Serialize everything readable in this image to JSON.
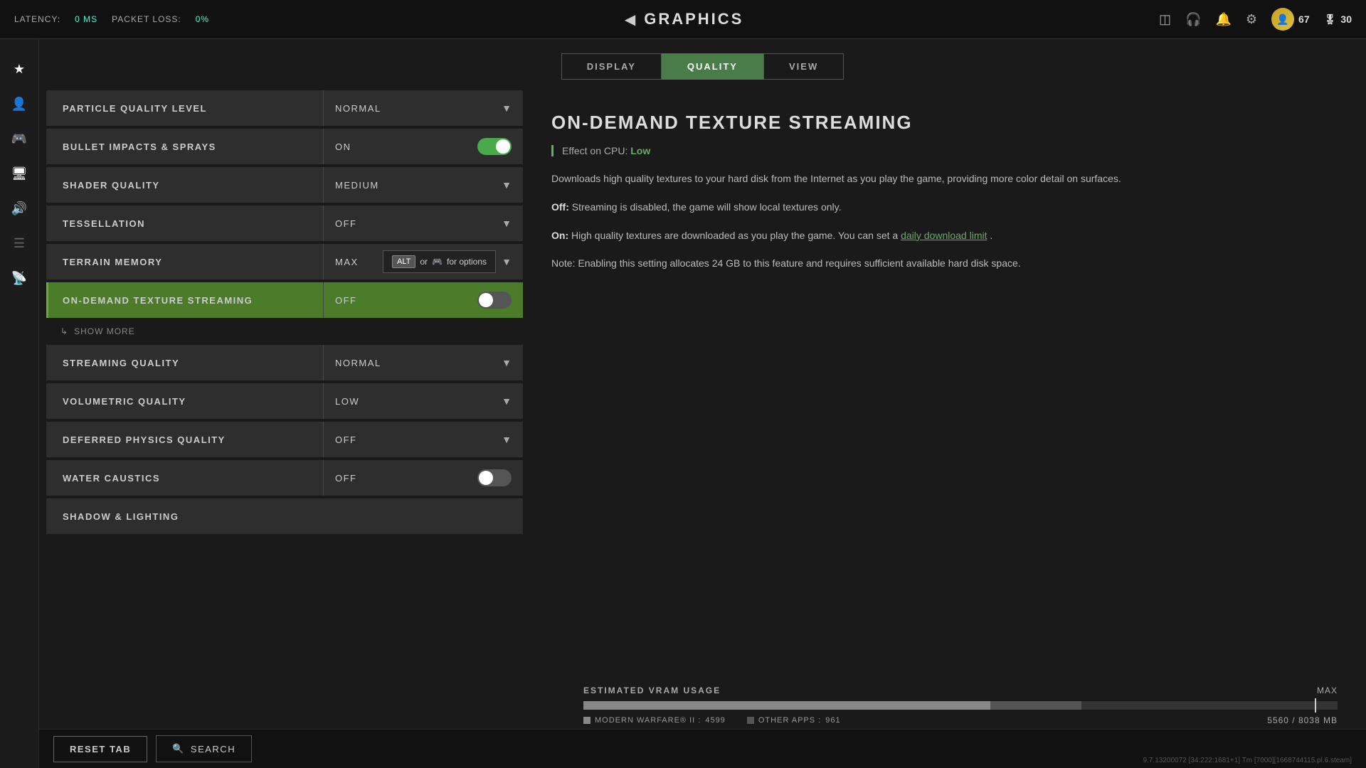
{
  "topbar": {
    "latency_label": "LATENCY:",
    "latency_value": "0 MS",
    "packet_loss_label": "PACKET LOSS:",
    "packet_loss_value": "0%",
    "title": "GRAPHICS",
    "player_count": "67",
    "credits_icon": "⚙",
    "credits": "30"
  },
  "tabs": [
    {
      "id": "display",
      "label": "DISPLAY",
      "active": false
    },
    {
      "id": "quality",
      "label": "QUALITY",
      "active": true
    },
    {
      "id": "view",
      "label": "VIEW",
      "active": false
    }
  ],
  "settings": [
    {
      "id": "particle_quality_level",
      "label": "PARTICLE QUALITY LEVEL",
      "value": "NORMAL",
      "type": "dropdown",
      "highlighted": false
    },
    {
      "id": "bullet_impacts_sprays",
      "label": "BULLET IMPACTS & SPRAYS",
      "value": "ON",
      "type": "toggle",
      "toggle_on": true,
      "highlighted": false
    },
    {
      "id": "shader_quality",
      "label": "SHADER QUALITY",
      "value": "MEDIUM",
      "type": "dropdown",
      "highlighted": false
    },
    {
      "id": "tessellation",
      "label": "TESSELLATION",
      "value": "OFF",
      "type": "dropdown",
      "highlighted": false
    },
    {
      "id": "terrain_memory",
      "label": "TERRAIN MEMORY",
      "value": "MAX",
      "type": "dropdown",
      "highlighted": false
    },
    {
      "id": "on_demand_texture_streaming",
      "label": "ON-DEMAND TEXTURE STREAMING",
      "value": "OFF",
      "type": "toggle",
      "toggle_on": false,
      "highlighted": true
    },
    {
      "id": "show_more",
      "label": "SHOW MORE",
      "type": "show_more"
    },
    {
      "id": "streaming_quality",
      "label": "STREAMING QUALITY",
      "value": "NORMAL",
      "type": "dropdown",
      "highlighted": false
    },
    {
      "id": "volumetric_quality",
      "label": "VOLUMETRIC QUALITY",
      "value": "LOW",
      "type": "dropdown",
      "highlighted": false
    },
    {
      "id": "deferred_physics_quality",
      "label": "DEFERRED PHYSICS QUALITY",
      "value": "OFF",
      "type": "dropdown",
      "highlighted": false
    },
    {
      "id": "water_caustics",
      "label": "WATER CAUSTICS",
      "value": "OFF",
      "type": "toggle",
      "toggle_on": false,
      "highlighted": false
    },
    {
      "id": "shadow_lighting",
      "label": "SHADOW & LIGHTING",
      "value": "",
      "type": "section_header",
      "highlighted": false
    }
  ],
  "tooltip": {
    "alt_key": "ALT",
    "text": "or",
    "controller_text": "🎮",
    "suffix": "for options"
  },
  "info_panel": {
    "title": "ON-DEMAND TEXTURE STREAMING",
    "cpu_effect_label": "Effect on CPU:",
    "cpu_effect_value": "Low",
    "description": "Downloads high quality textures to your hard disk from the Internet as you play the game, providing more color detail on surfaces.",
    "off_description": "Streaming is disabled, the game will show local textures only.",
    "on_description": "High quality textures are downloaded as you play the game. You can set a",
    "daily_limit_link": "daily download limit",
    "on_description_suffix": ".",
    "note": "Note: Enabling this setting allocates 24 GB to this feature and requires sufficient available hard disk space."
  },
  "vram": {
    "title": "ESTIMATED VRAM USAGE",
    "max_label": "MAX",
    "mw_label": "MODERN WARFARE® II :",
    "mw_value": "4599",
    "other_label": "OTHER APPS :",
    "other_value": "961",
    "total": "5560 / 8038 MB",
    "mw_percent": 54,
    "other_percent": 12,
    "max_percent": 97
  },
  "bottom": {
    "reset_tab_label": "RESET TAB",
    "search_label": "SEARCH",
    "build_info": "9.7.13200072 [34:222:1681+1] Tm [7000][1668744115.pl.6.steam]"
  }
}
